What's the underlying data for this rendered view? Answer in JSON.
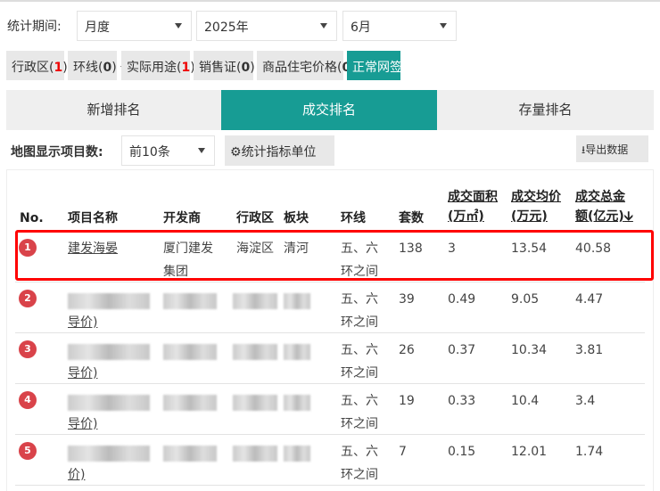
{
  "period": {
    "label": "统计期间:",
    "type": "月度",
    "year": "2025年",
    "month": "6月"
  },
  "filters": [
    {
      "name": "行政区",
      "count": "1"
    },
    {
      "name": "环线",
      "count": "0"
    },
    {
      "name": "实际用途",
      "count": "1"
    },
    {
      "name": "销售证",
      "count": "0"
    },
    {
      "name": "商品住宅价格",
      "count": "0"
    }
  ],
  "normal_sign": "正常网签",
  "tabs": [
    "新增排名",
    "成交排名",
    "存量排名"
  ],
  "map_count": {
    "label": "地图显示项目数:",
    "value": "前10条"
  },
  "unit_button": "统计指标单位",
  "export_button": "导出数据",
  "headers": {
    "no": "No.",
    "name": "项目名称",
    "developer": "开发商",
    "district": "行政区",
    "block": "板块",
    "ring": "环线",
    "units": "套数",
    "area": [
      "成交面积",
      "(万㎡)"
    ],
    "price": [
      "成交均价",
      "(万元)"
    ],
    "total": [
      "成交总金",
      "额(亿元)"
    ]
  },
  "rows": [
    {
      "rank": "1",
      "name": "建发海晏",
      "developer": [
        "厦门建发",
        "集团"
      ],
      "district": "海淀区",
      "block": "清河",
      "ring": [
        "五、六",
        "环之间"
      ],
      "units": "138",
      "area": "3",
      "price": "13.54",
      "total": "40.58"
    },
    {
      "rank": "2",
      "name_tail": "导价)",
      "ring": [
        "五、六",
        "环之间"
      ],
      "units": "39",
      "area": "0.49",
      "price": "9.05",
      "total": "4.47"
    },
    {
      "rank": "3",
      "name_tail": "导价)",
      "ring": [
        "五、六",
        "环之间"
      ],
      "units": "26",
      "area": "0.37",
      "price": "10.34",
      "total": "3.81"
    },
    {
      "rank": "4",
      "name_tail": "导价)",
      "ring": [
        "五、六",
        "环之间"
      ],
      "units": "19",
      "area": "0.33",
      "price": "10.4",
      "total": "3.4"
    },
    {
      "rank": "5",
      "name_tail": "价)",
      "ring": [
        "五、六",
        "环之间"
      ],
      "units": "7",
      "area": "0.15",
      "price": "12.01",
      "total": "1.74"
    }
  ]
}
